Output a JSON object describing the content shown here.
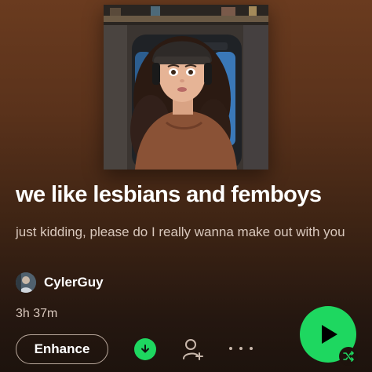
{
  "playlist": {
    "title": "we like lesbians and femboys",
    "description": "just kidding, please do I really wanna make out with you",
    "owner": "CylerGuy",
    "duration": "3h 37m"
  },
  "actions": {
    "enhance_label": "Enhance",
    "download_icon": "download-icon",
    "add_user_icon": "add-user-icon",
    "more_icon": "more-icon",
    "play_icon": "play-icon",
    "shuffle_icon": "shuffle-icon"
  },
  "colors": {
    "accent": "#1ed760",
    "background_top": "#6a3b1f",
    "background_bottom": "#1d130d",
    "secondary_text": "#d9c8bd"
  }
}
